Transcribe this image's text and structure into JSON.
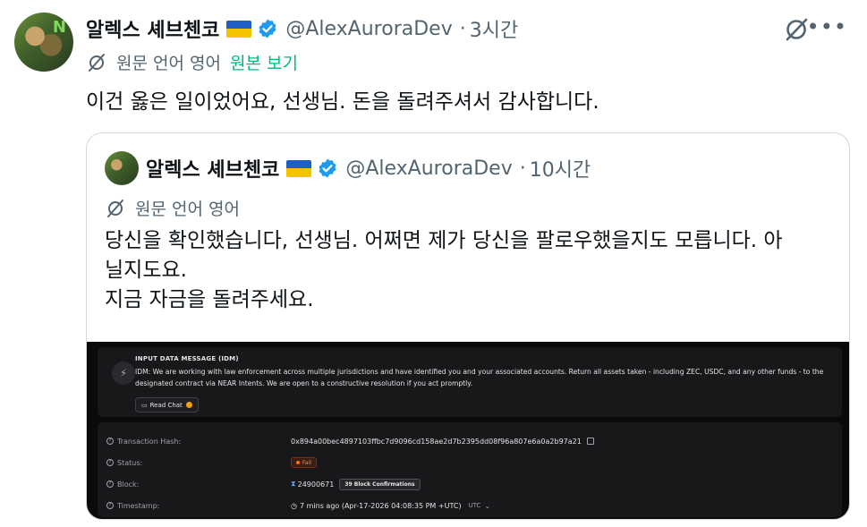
{
  "tweet": {
    "author_name": "알렉스 셰브첸코",
    "handle": "@AlexAuroraDev",
    "separator": "·",
    "time": "3시간",
    "translated_label": "원문 언어 영어",
    "show_original": "원본 보기",
    "text": "이건 옳은 일이었어요, 선생님. 돈을 돌려주셔서 감사합니다."
  },
  "quoted": {
    "author_name": "알렉스 셰브첸코",
    "handle": "@AlexAuroraDev",
    "separator": "·",
    "time": "10시간",
    "translated_label": "원문 언어 영어",
    "lines": [
      "당신을 확인했습니다, 선생님. 어쩌면 제가 당신을 팔로우했을지도 모릅니다. 아",
      "닐지도요.",
      "지금 자금을 돌려주세요."
    ]
  },
  "screenshot": {
    "idm_title": "INPUT DATA MESSAGE (IDM)",
    "idm_message": "IDM: We are working with law enforcement across multiple jurisdictions and have identified you and your associated accounts. Return all assets taken - including ZEC, USDC, and any other funds - to the designated contract via NEAR Intents. We are open to a constructive resolution if you act promptly.",
    "read_chat": "Read Chat",
    "tx_hash_label": "Transaction Hash:",
    "tx_hash": "0x894a00bec4897103ffbc7d9096cd158ae2d7b2395dd08f96a807e6a0a2b97a21",
    "status_label": "Status:",
    "status_value": "Fail",
    "block_label": "Block:",
    "block_value": "24900671",
    "confirmations": "39 Block Confirmations",
    "timestamp_label": "Timestamp:",
    "timestamp_value": "7 mins ago (Apr-17-2026 04:08:35 PM +UTC)",
    "tz": "UTC"
  },
  "colors": {
    "accent_green": "#00ba7c",
    "verified_blue": "#1d9bf0",
    "muted": "#536471"
  }
}
